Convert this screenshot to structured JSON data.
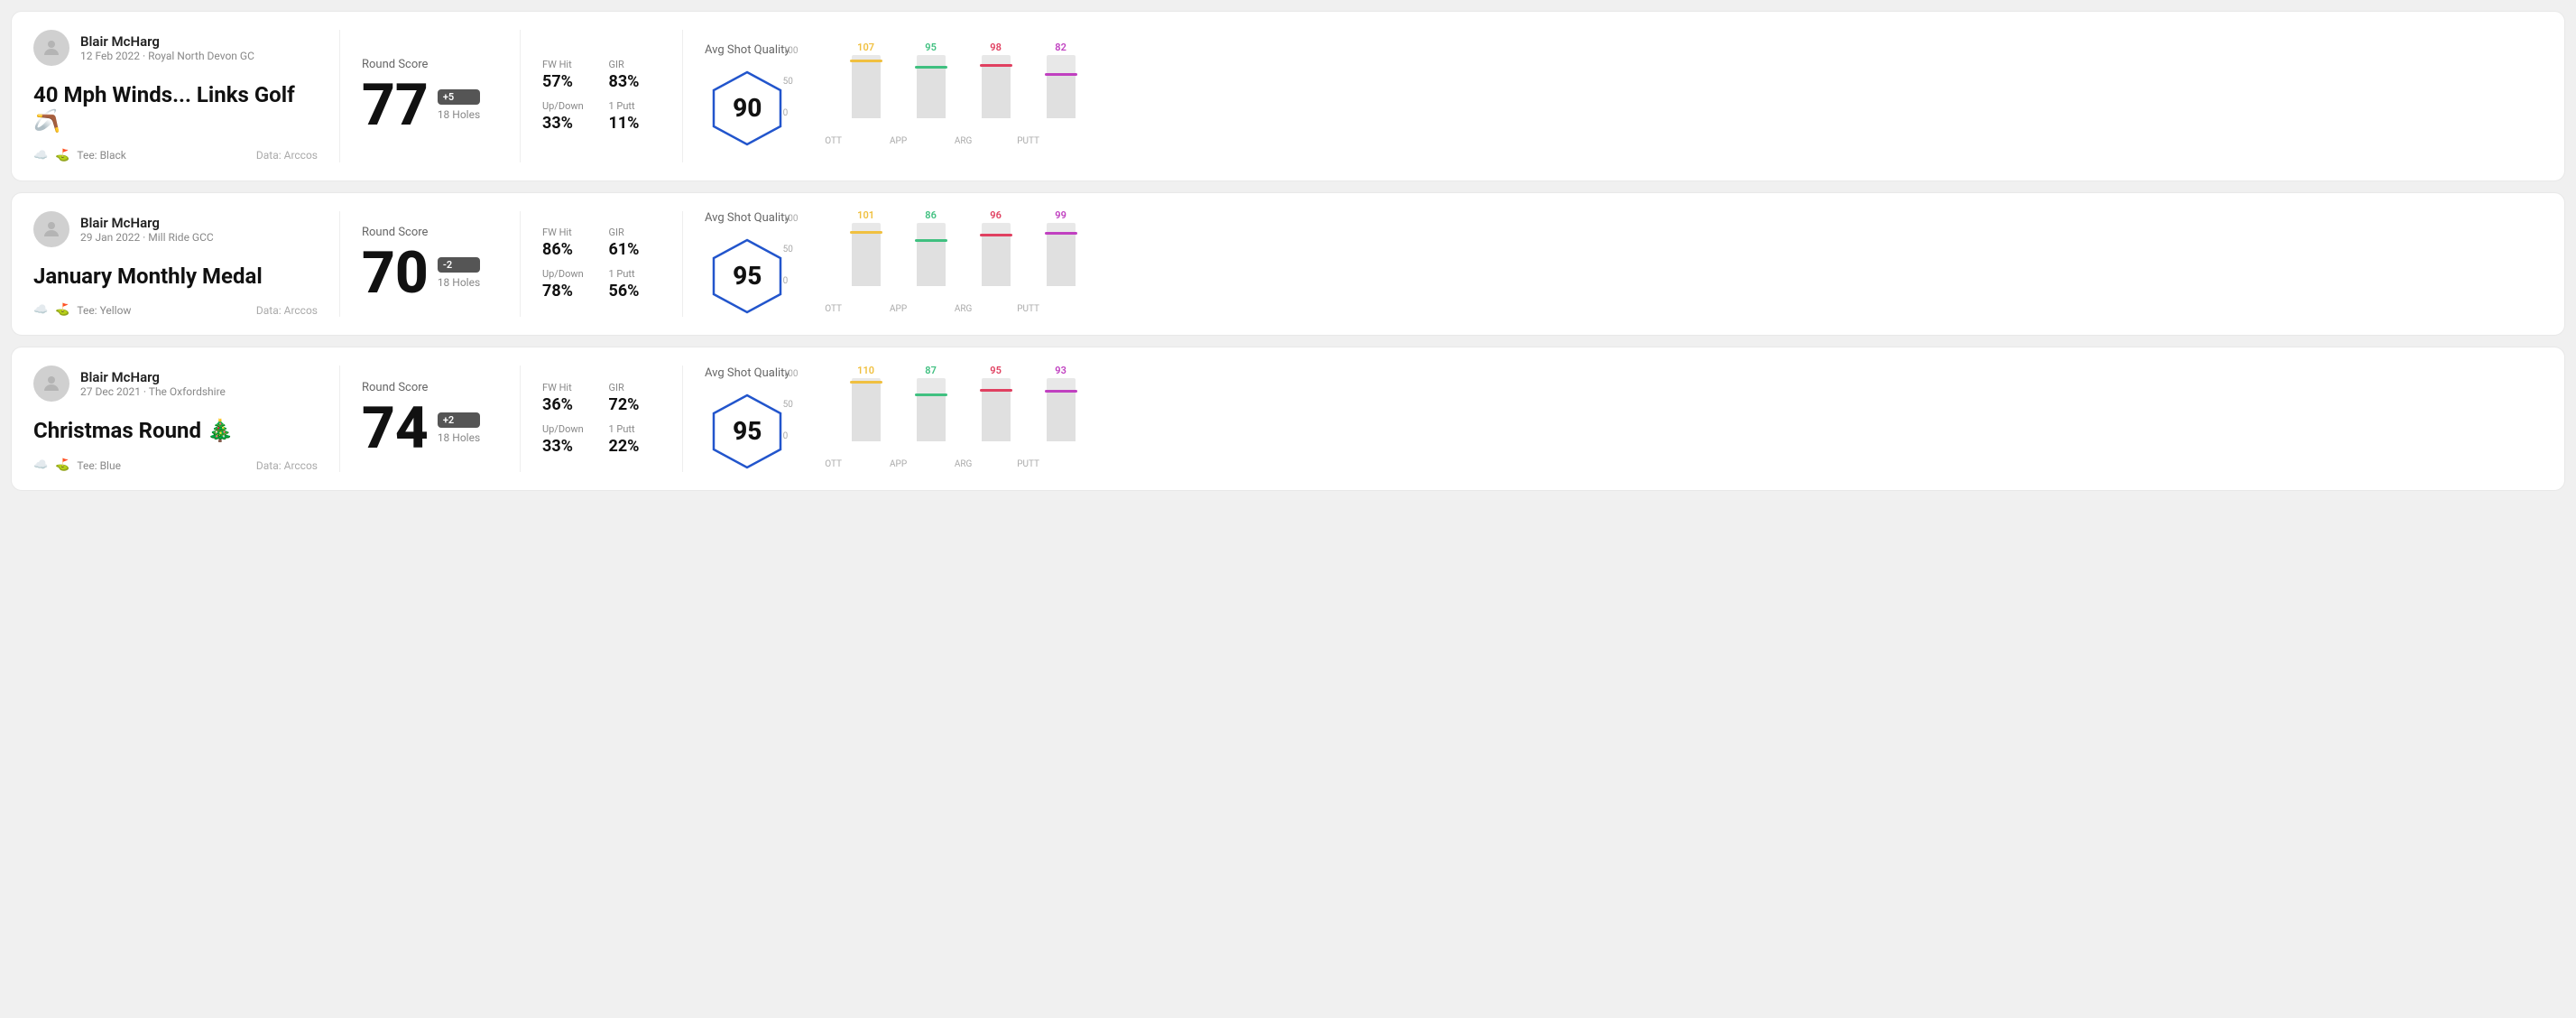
{
  "rounds": [
    {
      "name": "Blair McHarg",
      "date": "12 Feb 2022 · Royal North Devon GC",
      "title": "40 Mph Winds... Links Golf 🪃",
      "tee": "Black",
      "data_source": "Data: Arccos",
      "round_score_label": "Round Score",
      "score": "77",
      "badge": "+5",
      "holes": "18 Holes",
      "fw_hit": "57%",
      "gir": "83%",
      "up_down": "33%",
      "one_putt": "11%",
      "avg_quality_label": "Avg Shot Quality",
      "quality_score": "90",
      "chart": {
        "bars": [
          {
            "label": "OTT",
            "value": 107,
            "color": "#f0c040"
          },
          {
            "label": "APP",
            "value": 95,
            "color": "#40c080"
          },
          {
            "label": "ARG",
            "value": 98,
            "color": "#e04060"
          },
          {
            "label": "PUTT",
            "value": 82,
            "color": "#c040c0"
          }
        ]
      }
    },
    {
      "name": "Blair McHarg",
      "date": "29 Jan 2022 · Mill Ride GCC",
      "title": "January Monthly Medal",
      "tee": "Yellow",
      "data_source": "Data: Arccos",
      "round_score_label": "Round Score",
      "score": "70",
      "badge": "-2",
      "holes": "18 Holes",
      "fw_hit": "86%",
      "gir": "61%",
      "up_down": "78%",
      "one_putt": "56%",
      "avg_quality_label": "Avg Shot Quality",
      "quality_score": "95",
      "chart": {
        "bars": [
          {
            "label": "OTT",
            "value": 101,
            "color": "#f0c040"
          },
          {
            "label": "APP",
            "value": 86,
            "color": "#40c080"
          },
          {
            "label": "ARG",
            "value": 96,
            "color": "#e04060"
          },
          {
            "label": "PUTT",
            "value": 99,
            "color": "#c040c0"
          }
        ]
      }
    },
    {
      "name": "Blair McHarg",
      "date": "27 Dec 2021 · The Oxfordshire",
      "title": "Christmas Round 🎄",
      "tee": "Blue",
      "data_source": "Data: Arccos",
      "round_score_label": "Round Score",
      "score": "74",
      "badge": "+2",
      "holes": "18 Holes",
      "fw_hit": "36%",
      "gir": "72%",
      "up_down": "33%",
      "one_putt": "22%",
      "avg_quality_label": "Avg Shot Quality",
      "quality_score": "95",
      "chart": {
        "bars": [
          {
            "label": "OTT",
            "value": 110,
            "color": "#f0c040"
          },
          {
            "label": "APP",
            "value": 87,
            "color": "#40c080"
          },
          {
            "label": "ARG",
            "value": 95,
            "color": "#e04060"
          },
          {
            "label": "PUTT",
            "value": 93,
            "color": "#c040c0"
          }
        ]
      }
    }
  ],
  "y_axis": [
    "100",
    "50",
    "0"
  ]
}
